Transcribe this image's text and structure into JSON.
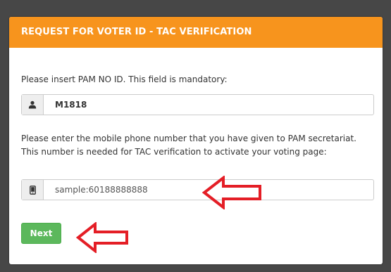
{
  "header": {
    "title": "REQUEST FOR VOTER ID - TAC VERIFICATION",
    "color": "#f7941d"
  },
  "pam_field": {
    "label": "Please insert PAM NO ID. This field is mandatory:",
    "icon": "user-icon",
    "value": "M1818"
  },
  "phone_field": {
    "label": "Please enter the mobile phone number that you have given to PAM secretariat. This number is needed for TAC verification to activate your voting page:",
    "icon": "mobile-phone-icon",
    "placeholder": "sample:60188888888"
  },
  "next_button": {
    "label": "Next",
    "color": "#5cb85c"
  },
  "annotations": {
    "arrow_color": "#e41e26",
    "arrow_icon": "left-arrow-icon"
  }
}
